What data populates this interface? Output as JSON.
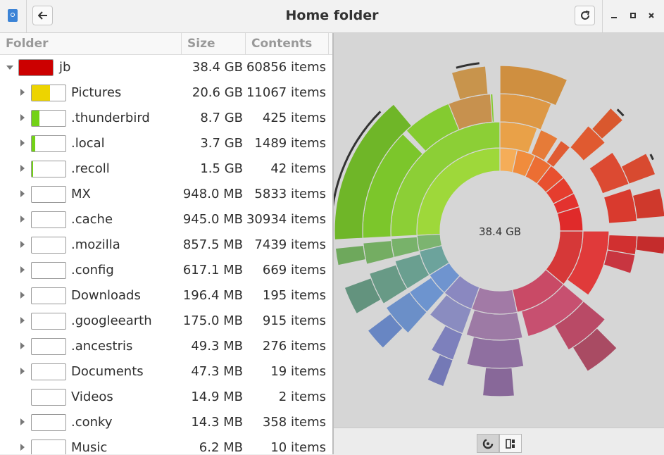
{
  "window": {
    "title": "Home folder",
    "back_icon": "arrow-left-icon",
    "refresh_icon": "refresh-icon"
  },
  "columns": {
    "folder": "Folder",
    "size": "Size",
    "contents": "Contents"
  },
  "rows": [
    {
      "name": "jb",
      "size": "38.4 GB",
      "contents": "60856 items",
      "fill": 1.0,
      "color": "#cc0000",
      "expander": "open"
    },
    {
      "name": "Pictures",
      "size": "20.6 GB",
      "contents": "11067 items",
      "fill": 0.536,
      "color": "#edd400",
      "expander": "closed"
    },
    {
      "name": ".thunderbird",
      "size": "8.7 GB",
      "contents": "425 items",
      "fill": 0.227,
      "color": "#73d216",
      "expander": "closed"
    },
    {
      "name": ".local",
      "size": "3.7 GB",
      "contents": "1489 items",
      "fill": 0.096,
      "color": "#73d216",
      "expander": "closed"
    },
    {
      "name": ".recoll",
      "size": "1.5 GB",
      "contents": "42 items",
      "fill": 0.039,
      "color": "#73d216",
      "expander": "closed"
    },
    {
      "name": "MX",
      "size": "948.0 MB",
      "contents": "5833 items",
      "fill": 0.0,
      "color": "#73d216",
      "expander": "closed"
    },
    {
      "name": ".cache",
      "size": "945.0 MB",
      "contents": "30934 items",
      "fill": 0.0,
      "color": "#73d216",
      "expander": "closed"
    },
    {
      "name": ".mozilla",
      "size": "857.5 MB",
      "contents": "7439 items",
      "fill": 0.0,
      "color": "#73d216",
      "expander": "closed"
    },
    {
      "name": ".config",
      "size": "617.1 MB",
      "contents": "669 items",
      "fill": 0.0,
      "color": "#73d216",
      "expander": "closed"
    },
    {
      "name": "Downloads",
      "size": "196.4 MB",
      "contents": "195 items",
      "fill": 0.0,
      "color": "#73d216",
      "expander": "closed"
    },
    {
      "name": ".googleearth",
      "size": "175.0 MB",
      "contents": "915 items",
      "fill": 0.0,
      "color": "#73d216",
      "expander": "closed"
    },
    {
      "name": ".ancestris",
      "size": "49.3 MB",
      "contents": "276 items",
      "fill": 0.0,
      "color": "#73d216",
      "expander": "closed"
    },
    {
      "name": "Documents",
      "size": "47.3 MB",
      "contents": "19 items",
      "fill": 0.0,
      "color": "#73d216",
      "expander": "closed"
    },
    {
      "name": "Videos",
      "size": "14.9 MB",
      "contents": "2 items",
      "fill": 0.0,
      "color": "#73d216",
      "expander": "none"
    },
    {
      "name": ".conky",
      "size": "14.3 MB",
      "contents": "358 items",
      "fill": 0.0,
      "color": "#73d216",
      "expander": "closed"
    },
    {
      "name": "Music",
      "size": "6.2 MB",
      "contents": "10 items",
      "fill": 0.0,
      "color": "#73d216",
      "expander": "closed"
    }
  ],
  "chart": {
    "center_label": "38.4 GB"
  },
  "view_buttons": [
    {
      "icon": "rings-chart-icon",
      "active": true
    },
    {
      "icon": "treemap-chart-icon",
      "active": false
    }
  ]
}
